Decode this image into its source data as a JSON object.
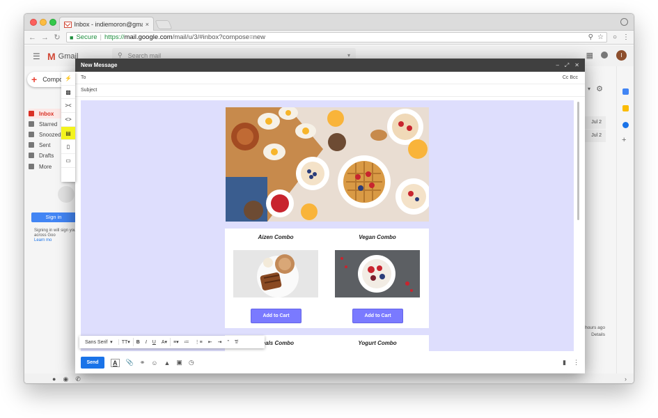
{
  "browser": {
    "tab_title": "Inbox - indiemoron@gmail.com",
    "tab_close": "×",
    "url_secure_label": "Secure",
    "url_scheme": "https://",
    "url_host": "mail.google.com",
    "url_path": "/mail/u/3/#inbox?compose=new"
  },
  "gmail": {
    "logo_text": "Gmail",
    "search_placeholder": "Search mail",
    "compose_label": "Compose",
    "user_initial": "I",
    "nav": [
      {
        "label": "Inbox"
      },
      {
        "label": "Starred"
      },
      {
        "label": "Snoozed"
      },
      {
        "label": "Sent"
      },
      {
        "label": "Drafts"
      },
      {
        "label": "More"
      }
    ],
    "signin_button": "Sign in",
    "signin_text": "Signing in will sign you",
    "signin_text2": "across Goo",
    "learn_more": "Learn mo",
    "dates": [
      "Jul 2",
      "Jul 2"
    ],
    "recent_time": "hours ago",
    "recent_details": "Details"
  },
  "compose": {
    "title": "New Message",
    "to_label": "To",
    "cc_bcc_label": "Cc Bcc",
    "subject_label": "Subject",
    "send_label": "Send",
    "products": [
      {
        "name": "Aizen Combo",
        "button": "Add to Cart"
      },
      {
        "name": "Vegan Combo",
        "button": "Add to Cart"
      },
      {
        "name": "Meals Combo"
      },
      {
        "name": "Yogurt Combo"
      }
    ]
  },
  "format_toolbar": {
    "font": "Sans Serif"
  },
  "colors": {
    "editor_bg": "#dedefd",
    "cart_button": "#7a7aff",
    "send_button": "#1a73e8",
    "compose_header": "#404040"
  }
}
